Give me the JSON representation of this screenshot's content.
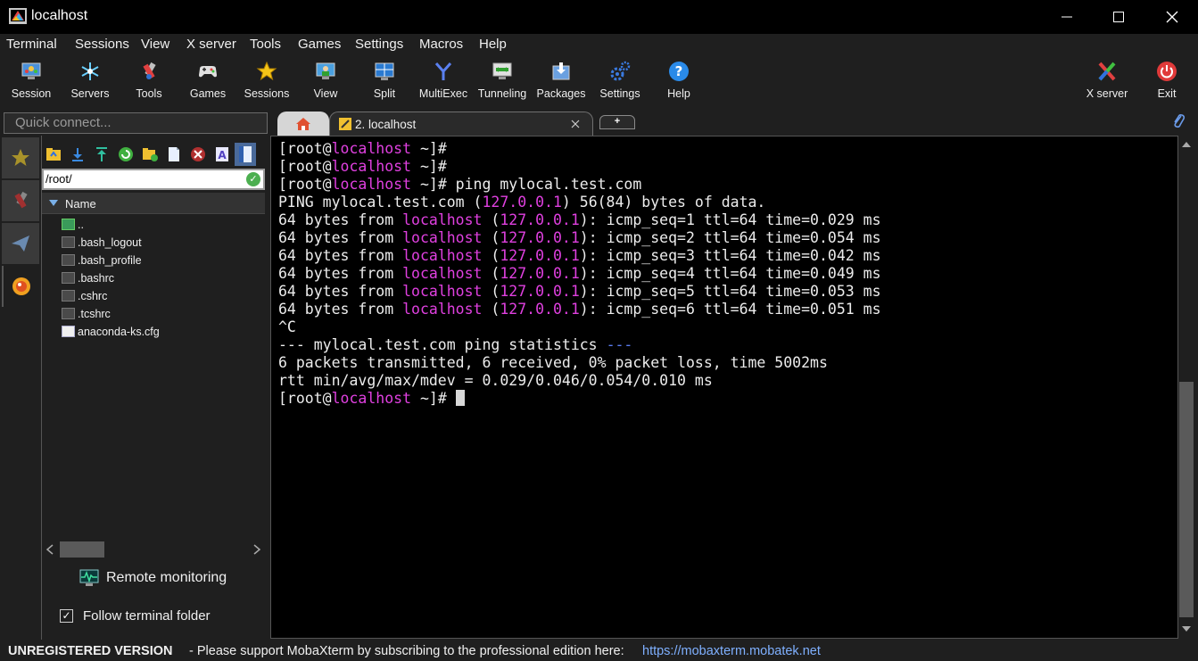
{
  "window": {
    "title": "localhost",
    "minimize_icon": "minimize-icon",
    "maximize_icon": "maximize-icon",
    "close_icon": "close-icon"
  },
  "menu": [
    "Terminal",
    "Sessions",
    "View",
    "X server",
    "Tools",
    "Games",
    "Settings",
    "Macros",
    "Help"
  ],
  "toolbar": [
    {
      "label": "Session",
      "icon": "monitor-icon"
    },
    {
      "label": "Servers",
      "icon": "servers-icon"
    },
    {
      "label": "Tools",
      "icon": "tools-icon"
    },
    {
      "label": "Games",
      "icon": "gamepad-icon"
    },
    {
      "label": "Sessions",
      "icon": "star-icon"
    },
    {
      "label": "View",
      "icon": "view-icon"
    },
    {
      "label": "Split",
      "icon": "split-icon"
    },
    {
      "label": "MultiExec",
      "icon": "multiexec-icon"
    },
    {
      "label": "Tunneling",
      "icon": "tunneling-icon"
    },
    {
      "label": "Packages",
      "icon": "packages-icon"
    },
    {
      "label": "Settings",
      "icon": "gears-icon"
    },
    {
      "label": "Help",
      "icon": "help-icon"
    }
  ],
  "toolbar_right": [
    {
      "label": "X server",
      "icon": "x-server-icon"
    },
    {
      "label": "Exit",
      "icon": "power-icon"
    }
  ],
  "quick_connect": {
    "placeholder": "Quick connect..."
  },
  "tabs": {
    "home_icon": "home-icon",
    "session_label": "2. localhost",
    "new_tab": "+"
  },
  "file_panel": {
    "path": "/root/",
    "column_name": "Name",
    "files": [
      "..",
      ".bash_logout",
      ".bash_profile",
      ".bashrc",
      ".cshrc",
      ".tcshrc",
      "anaconda-ks.cfg"
    ],
    "remote_monitoring": "Remote monitoring",
    "follow_terminal_folder": "Follow terminal folder",
    "follow_checked": true
  },
  "terminal": {
    "lines": [
      [
        {
          "t": "[root@"
        },
        {
          "t": "localhost",
          "c": "mag"
        },
        {
          "t": " ~]#"
        }
      ],
      [
        {
          "t": "[root@"
        },
        {
          "t": "localhost",
          "c": "mag"
        },
        {
          "t": " ~]#"
        }
      ],
      [
        {
          "t": "[root@"
        },
        {
          "t": "localhost",
          "c": "mag"
        },
        {
          "t": " ~]# ping mylocal.test.com"
        }
      ],
      [
        {
          "t": "PING mylocal.test.com ("
        },
        {
          "t": "127.0.0.1",
          "c": "mag"
        },
        {
          "t": ") 56(84) bytes of data."
        }
      ],
      [
        {
          "t": "64 bytes from "
        },
        {
          "t": "localhost",
          "c": "mag"
        },
        {
          "t": " ("
        },
        {
          "t": "127.0.0.1",
          "c": "mag"
        },
        {
          "t": "): icmp_seq=1 ttl=64 time=0.029 ms"
        }
      ],
      [
        {
          "t": "64 bytes from "
        },
        {
          "t": "localhost",
          "c": "mag"
        },
        {
          "t": " ("
        },
        {
          "t": "127.0.0.1",
          "c": "mag"
        },
        {
          "t": "): icmp_seq=2 ttl=64 time=0.054 ms"
        }
      ],
      [
        {
          "t": "64 bytes from "
        },
        {
          "t": "localhost",
          "c": "mag"
        },
        {
          "t": " ("
        },
        {
          "t": "127.0.0.1",
          "c": "mag"
        },
        {
          "t": "): icmp_seq=3 ttl=64 time=0.042 ms"
        }
      ],
      [
        {
          "t": "64 bytes from "
        },
        {
          "t": "localhost",
          "c": "mag"
        },
        {
          "t": " ("
        },
        {
          "t": "127.0.0.1",
          "c": "mag"
        },
        {
          "t": "): icmp_seq=4 ttl=64 time=0.049 ms"
        }
      ],
      [
        {
          "t": "64 bytes from "
        },
        {
          "t": "localhost",
          "c": "mag"
        },
        {
          "t": " ("
        },
        {
          "t": "127.0.0.1",
          "c": "mag"
        },
        {
          "t": "): icmp_seq=5 ttl=64 time=0.053 ms"
        }
      ],
      [
        {
          "t": "64 bytes from "
        },
        {
          "t": "localhost",
          "c": "mag"
        },
        {
          "t": " ("
        },
        {
          "t": "127.0.0.1",
          "c": "mag"
        },
        {
          "t": "): icmp_seq=6 ttl=64 time=0.051 ms"
        }
      ],
      [
        {
          "t": "^C"
        }
      ],
      [
        {
          "t": "--- mylocal.test.com ping statistics "
        },
        {
          "t": "---",
          "c": "blu"
        }
      ],
      [
        {
          "t": "6 packets transmitted, 6 received, 0% packet loss, time 5002ms"
        }
      ],
      [
        {
          "t": "rtt min/avg/max/mdev = 0.029/0.046/0.054/0.010 ms"
        }
      ],
      [
        {
          "t": "[root@"
        },
        {
          "t": "localhost",
          "c": "mag"
        },
        {
          "t": " ~]# "
        },
        {
          "cursor": true
        }
      ]
    ]
  },
  "status": {
    "unregistered": "UNREGISTERED VERSION",
    "message": "-  Please support MobaXterm by subscribing to the professional edition here:",
    "link": "https://mobaxterm.mobatek.net"
  },
  "colors": {
    "highlight_magenta": "#e040e0",
    "highlight_blue": "#5a7cf0",
    "link": "#7fb0ff"
  }
}
